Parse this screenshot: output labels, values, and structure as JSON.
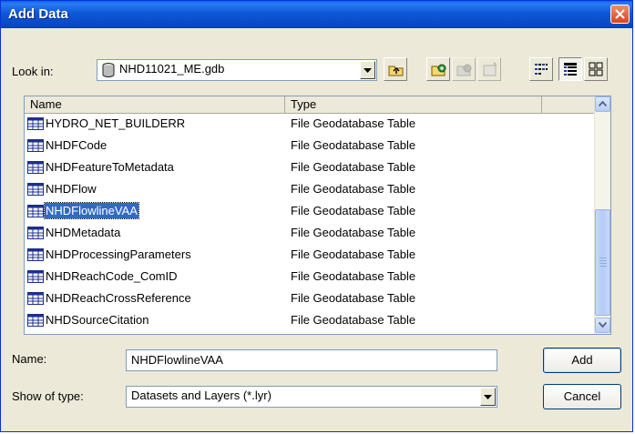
{
  "window": {
    "title": "Add Data"
  },
  "lookin": {
    "label": "Look in:",
    "value": "NHD11021_ME.gdb"
  },
  "toolbar": {
    "buttons": [
      "up-one-level",
      "connect-to-folder",
      "disconnect-folder",
      "catalog-options",
      "list-view",
      "details-view",
      "thumbnails-view"
    ]
  },
  "list": {
    "columns": [
      "Name",
      "Type"
    ],
    "rows": [
      {
        "name": "HYDRO_NET_BUILDERR",
        "type": "File Geodatabase Table"
      },
      {
        "name": "NHDFCode",
        "type": "File Geodatabase Table"
      },
      {
        "name": "NHDFeatureToMetadata",
        "type": "File Geodatabase Table"
      },
      {
        "name": "NHDFlow",
        "type": "File Geodatabase Table"
      },
      {
        "name": "NHDFlowlineVAA",
        "type": "File Geodatabase Table"
      },
      {
        "name": "NHDMetadata",
        "type": "File Geodatabase Table"
      },
      {
        "name": "NHDProcessingParameters",
        "type": "File Geodatabase Table"
      },
      {
        "name": "NHDReachCode_ComID",
        "type": "File Geodatabase Table"
      },
      {
        "name": "NHDReachCrossReference",
        "type": "File Geodatabase Table"
      },
      {
        "name": "NHDSourceCitation",
        "type": "File Geodatabase Table"
      }
    ],
    "selected_row": "NHDFlowlineVAA"
  },
  "name_field": {
    "label": "Name:",
    "value": "NHDFlowlineVAA"
  },
  "type_field": {
    "label": "Show of type:",
    "value": "Datasets and Layers (*.lyr)"
  },
  "buttons": {
    "add": "Add",
    "cancel": "Cancel"
  },
  "colors": {
    "titlebar": "#0a58d8",
    "selection": "#316ac5",
    "dialog": "#ece9d8"
  }
}
